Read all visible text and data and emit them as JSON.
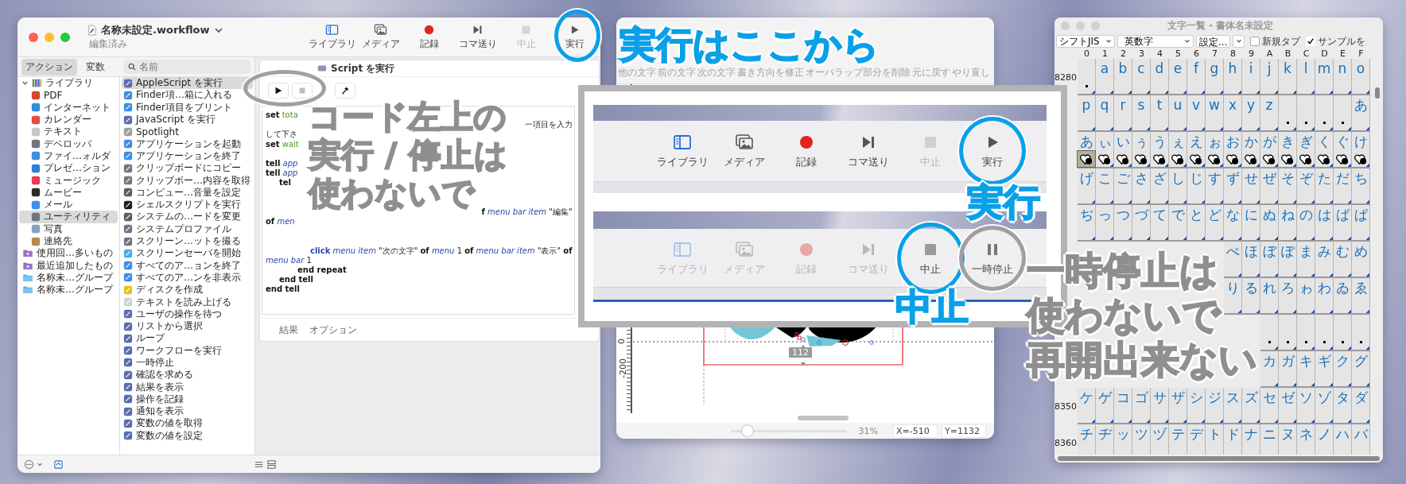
{
  "automator": {
    "title": "名称未設定.workflow",
    "subtitle": "編集済み",
    "toolbar": [
      {
        "label": "ライブラリ",
        "kind": "library",
        "disabled": false
      },
      {
        "label": "メディア",
        "kind": "media",
        "disabled": false
      },
      {
        "label": "記録",
        "kind": "record",
        "disabled": false
      },
      {
        "label": "コマ送り",
        "kind": "step",
        "disabled": false
      },
      {
        "label": "中止",
        "kind": "stop",
        "disabled": true
      },
      {
        "label": "実行",
        "kind": "run",
        "disabled": false
      }
    ],
    "sidebar_tabs": [
      {
        "label": "アクション",
        "selected": true
      },
      {
        "label": "変数",
        "selected": false
      }
    ],
    "search": {
      "placeholder": "名前"
    },
    "library": {
      "label": "ライブラリ",
      "expanded": true,
      "selected": false,
      "children": [
        {
          "label": "PDF",
          "color": "#d9442f",
          "selected": false
        },
        {
          "label": "インターネット",
          "color": "#2f8fd9",
          "selected": false
        },
        {
          "label": "カレンダー",
          "color": "#e84b3c",
          "selected": false
        },
        {
          "label": "テキスト",
          "color": "#c8c8c8",
          "selected": false
        },
        {
          "label": "デベロッパ",
          "color": "#6f7683",
          "selected": false
        },
        {
          "label": "ファイ…ォルダ",
          "color": "#3b8fe0",
          "selected": false
        },
        {
          "label": "プレゼ…ション",
          "color": "#2f7fe0",
          "selected": false
        },
        {
          "label": "ミュージック",
          "color": "#f03a4f",
          "selected": false
        },
        {
          "label": "ムービー",
          "color": "#2b2b2b",
          "selected": false
        },
        {
          "label": "メール",
          "color": "#3d8ff0",
          "selected": false
        },
        {
          "label": "ユーティリティ",
          "color": "#6f7683",
          "selected": true
        },
        {
          "label": "写真",
          "color": "#8aa0c0",
          "selected": false
        },
        {
          "label": "連絡先",
          "color": "#b58a4a",
          "selected": false
        }
      ]
    },
    "groups": [
      {
        "label": "使用回…多いもの",
        "kind": "smart",
        "selected": false
      },
      {
        "label": "最近追加したもの",
        "kind": "smart",
        "selected": false
      },
      {
        "label": "名称未…グループ",
        "kind": "folder",
        "selected": false
      },
      {
        "label": "名称未…グループ",
        "kind": "folder",
        "selected": false
      }
    ],
    "actions": [
      {
        "label": "AppleScript を実行",
        "color": "#5a6cb0",
        "selected": true
      },
      {
        "label": "Finder項…箱に入れる",
        "color": "#3a8ee6",
        "selected": false
      },
      {
        "label": "Finder項目をプリント",
        "color": "#3a8ee6",
        "selected": false
      },
      {
        "label": "JavaScript を実行",
        "color": "#5a6cb0",
        "selected": false
      },
      {
        "label": "Spotlight",
        "color": "#a0a0a0",
        "selected": false
      },
      {
        "label": "アプリケーションを起動",
        "color": "#3a8ee6",
        "selected": false
      },
      {
        "label": "アプリケーションを終了",
        "color": "#3a8ee6",
        "selected": false
      },
      {
        "label": "クリップボードにコピー",
        "color": "#6f7683",
        "selected": false
      },
      {
        "label": "クリップボー…内容を取得",
        "color": "#6f7683",
        "selected": false
      },
      {
        "label": "コンピュー…音量を設定",
        "color": "#5c5c5c",
        "selected": false
      },
      {
        "label": "シェルスクリプトを実行",
        "color": "#1e1e1e",
        "selected": false
      },
      {
        "label": "システムの…ードを変更",
        "color": "#5c5c5c",
        "selected": false
      },
      {
        "label": "システムプロファイル",
        "color": "#6f7683",
        "selected": false
      },
      {
        "label": "スクリーン…ットを撮る",
        "color": "#6f7683",
        "selected": false
      },
      {
        "label": "スクリーンセーバを開始",
        "color": "#4aa8e8",
        "selected": false
      },
      {
        "label": "すべてのア…ョンを終了",
        "color": "#3a8ee6",
        "selected": false
      },
      {
        "label": "すべてのア…ンを非表示",
        "color": "#3a8ee6",
        "selected": false
      },
      {
        "label": "ディスクを作成",
        "color": "#e8c21a",
        "selected": false
      },
      {
        "label": "テキストを読み上げる",
        "color": "#d0d0d0",
        "selected": false
      },
      {
        "label": "ユーザの操作を待つ",
        "color": "#5a6cb0",
        "selected": false
      },
      {
        "label": "リストから選択",
        "color": "#5a6cb0",
        "selected": false
      },
      {
        "label": "ループ",
        "color": "#5a6cb0",
        "selected": false
      },
      {
        "label": "ワークフローを実行",
        "color": "#5a6cb0",
        "selected": false
      },
      {
        "label": "一時停止",
        "color": "#5a6cb0",
        "selected": false
      },
      {
        "label": "確認を求める",
        "color": "#5a6cb0",
        "selected": false
      },
      {
        "label": "結果を表示",
        "color": "#5a6cb0",
        "selected": false
      },
      {
        "label": "操作を記録",
        "color": "#5a6cb0",
        "selected": false
      },
      {
        "label": "通知を表示",
        "color": "#5a6cb0",
        "selected": false
      },
      {
        "label": "変数の値を取得",
        "color": "#5a6cb0",
        "selected": false
      },
      {
        "label": "変数の値を設定",
        "color": "#5a6cb0",
        "selected": false
      }
    ],
    "action_card": {
      "title": "Script を実行",
      "code": [
        {
          "kind": "text",
          "left": [
            {
              "text": "set",
              "kind": "keyword"
            },
            {
              "text": " tota",
              "kind": "variable"
            }
          ]
        },
        {
          "kind": "text",
          "right": [
            {
              "text": "一項目を入力",
              "kind": "plain"
            }
          ]
        },
        {
          "kind": "text",
          "left": [
            {
              "text": "して下さ",
              "kind": "plain"
            }
          ]
        },
        {
          "kind": "text",
          "left": [
            {
              "text": "set",
              "kind": "keyword"
            },
            {
              "text": " wait",
              "kind": "variable"
            }
          ]
        },
        {
          "kind": "blank"
        },
        {
          "kind": "text",
          "left": [
            {
              "text": "tell",
              "kind": "keyword"
            },
            {
              "text": " app",
              "kind": "term"
            }
          ]
        },
        {
          "kind": "text",
          "left": [
            {
              "text": "tell",
              "kind": "keyword"
            },
            {
              "text": " app",
              "kind": "term"
            }
          ]
        },
        {
          "kind": "indent1",
          "left": [
            {
              "text": "tel",
              "kind": "keyword"
            }
          ]
        },
        {
          "kind": "blank"
        },
        {
          "kind": "blank"
        },
        {
          "kind": "text",
          "right": [
            {
              "text": "f",
              "kind": "keyword"
            },
            {
              "text": " menu bar item",
              "kind": "term"
            },
            {
              "text": " \"編集\"",
              "kind": "plain"
            }
          ]
        },
        {
          "kind": "text",
          "left": [
            {
              "text": "of",
              "kind": "keyword"
            },
            {
              "text": " men",
              "kind": "term"
            }
          ]
        },
        {
          "kind": "blank"
        },
        {
          "kind": "blank"
        },
        {
          "kind": "indent3",
          "left": [
            {
              "text": "click",
              "kind": "command"
            },
            {
              "text": " menu item",
              "kind": "term"
            },
            {
              "text": " \"次の文字\" ",
              "kind": "plain"
            },
            {
              "text": "of",
              "kind": "keyword"
            },
            {
              "text": " menu",
              "kind": "term"
            },
            {
              "text": " 1 ",
              "kind": "plain"
            },
            {
              "text": "of",
              "kind": "keyword"
            },
            {
              "text": " menu bar item",
              "kind": "term"
            },
            {
              "text": " \"表示\" ",
              "kind": "plain"
            },
            {
              "text": "of",
              "kind": "keyword"
            }
          ]
        },
        {
          "kind": "text",
          "left": [
            {
              "text": "menu bar",
              "kind": "term"
            },
            {
              "text": " 1",
              "kind": "plain"
            }
          ]
        },
        {
          "kind": "indent2",
          "left": [
            {
              "text": "end repeat",
              "kind": "keyword"
            }
          ]
        },
        {
          "kind": "indent1",
          "left": [
            {
              "text": "end tell",
              "kind": "keyword"
            }
          ]
        },
        {
          "kind": "text",
          "left": [
            {
              "text": "end tell",
              "kind": "keyword"
            }
          ]
        }
      ],
      "tabs": [
        {
          "label": "結果"
        },
        {
          "label": "オプション"
        }
      ]
    }
  },
  "editor": {
    "toolbar": [
      "他の文字",
      "前の文字",
      "次の文字",
      "書き方向を修正",
      "オーバラップ部分を削除",
      "元に戻す",
      "やり直し"
    ],
    "ruler_labels": [
      "0",
      "-200"
    ],
    "measure": "112",
    "zoom": {
      "level": 0.15,
      "reading": "31%"
    },
    "x": "X=-510",
    "y": "Y=1132"
  },
  "char_table": {
    "title": "文字一覧 - 書体名未設定",
    "encoding": "シフトJIS",
    "range": "英数字",
    "settings_button": "設定...",
    "new_tab": {
      "label": "新規タブ",
      "checked": false
    },
    "sample": {
      "label": "サンプルを",
      "checked": true
    },
    "columns": [
      "0",
      "1",
      "2",
      "3",
      "4",
      "5",
      "6",
      "7",
      "8",
      "9",
      "A",
      "B",
      "C",
      "D",
      "E",
      "F"
    ],
    "rows": [
      {
        "kind": "glyphs",
        "label": "8280",
        "cells": [
          {
            "dot": true,
            "selected": false
          },
          {
            "glyph": "a",
            "selected": false
          },
          {
            "glyph": "b",
            "selected": false
          },
          {
            "glyph": "c",
            "selected": false
          },
          {
            "glyph": "d",
            "selected": false
          },
          {
            "glyph": "e",
            "selected": false
          },
          {
            "glyph": "f",
            "selected": false
          },
          {
            "glyph": "g",
            "selected": false
          },
          {
            "glyph": "h",
            "selected": false
          },
          {
            "glyph": "i",
            "selected": false
          },
          {
            "glyph": "j",
            "selected": false
          },
          {
            "glyph": "k",
            "selected": false
          },
          {
            "glyph": "l",
            "selected": false
          },
          {
            "glyph": "m",
            "selected": false
          },
          {
            "glyph": "n",
            "selected": false
          },
          {
            "glyph": "o",
            "selected": false
          }
        ]
      },
      {
        "kind": "glyphs",
        "cells": [
          {
            "glyph": "p",
            "selected": false
          },
          {
            "glyph": "q",
            "selected": false
          },
          {
            "glyph": "r",
            "selected": false
          },
          {
            "glyph": "s",
            "selected": false
          },
          {
            "glyph": "t",
            "selected": false
          },
          {
            "glyph": "u",
            "selected": false
          },
          {
            "glyph": "v",
            "selected": false
          },
          {
            "glyph": "w",
            "selected": false
          },
          {
            "glyph": "x",
            "selected": false
          },
          {
            "glyph": "y",
            "selected": false
          },
          {
            "glyph": "z",
            "selected": false
          },
          {
            "dot": true,
            "selected": false
          },
          {
            "dot": true,
            "selected": false
          },
          {
            "dot": true,
            "selected": false
          },
          {
            "dot": true,
            "selected": false
          },
          {
            "glyph": "あ",
            "selected": false
          }
        ]
      },
      {
        "kind": "samples",
        "cells": [
          {
            "glyph": "あ",
            "selected": true
          },
          {
            "glyph": "ぃ",
            "selected": false
          },
          {
            "glyph": "い",
            "selected": false
          },
          {
            "glyph": "ぅ",
            "selected": false
          },
          {
            "glyph": "う",
            "selected": false
          },
          {
            "glyph": "ぇ",
            "selected": false
          },
          {
            "glyph": "え",
            "selected": false
          },
          {
            "glyph": "ぉ",
            "selected": false
          },
          {
            "glyph": "お",
            "selected": false
          },
          {
            "glyph": "か",
            "selected": false
          },
          {
            "glyph": "が",
            "selected": false
          },
          {
            "glyph": "き",
            "selected": false
          },
          {
            "glyph": "ぎ",
            "selected": false
          },
          {
            "glyph": "く",
            "selected": false
          },
          {
            "glyph": "ぐ",
            "selected": false
          },
          {
            "glyph": "け",
            "selected": false
          }
        ]
      },
      {
        "kind": "glyphs",
        "cells": [
          {
            "glyph": "げ",
            "selected": false
          },
          {
            "glyph": "こ",
            "selected": false
          },
          {
            "glyph": "ご",
            "selected": false
          },
          {
            "glyph": "さ",
            "selected": false
          },
          {
            "glyph": "ざ",
            "selected": false
          },
          {
            "glyph": "し",
            "selected": false
          },
          {
            "glyph": "じ",
            "selected": false
          },
          {
            "glyph": "す",
            "selected": false
          },
          {
            "glyph": "ず",
            "selected": false
          },
          {
            "glyph": "せ",
            "selected": false
          },
          {
            "glyph": "ぜ",
            "selected": false
          },
          {
            "glyph": "そ",
            "selected": false
          },
          {
            "glyph": "ぞ",
            "selected": false
          },
          {
            "glyph": "た",
            "selected": false
          },
          {
            "glyph": "だ",
            "selected": false
          },
          {
            "glyph": "ち",
            "selected": false
          }
        ]
      },
      {
        "kind": "glyphs",
        "cells": [
          {
            "glyph": "ぢ",
            "selected": false
          },
          {
            "glyph": "っ",
            "selected": false
          },
          {
            "glyph": "つ",
            "selected": false
          },
          {
            "glyph": "づ",
            "selected": false
          },
          {
            "glyph": "て",
            "selected": false
          },
          {
            "glyph": "で",
            "selected": false
          },
          {
            "glyph": "と",
            "selected": false
          },
          {
            "glyph": "ど",
            "selected": false
          },
          {
            "glyph": "な",
            "selected": false
          },
          {
            "glyph": "に",
            "selected": false
          },
          {
            "glyph": "ぬ",
            "selected": false
          },
          {
            "glyph": "ね",
            "selected": false
          },
          {
            "glyph": "の",
            "selected": false
          },
          {
            "glyph": "は",
            "selected": false
          },
          {
            "glyph": "ば",
            "selected": false
          },
          {
            "glyph": "ぱ",
            "selected": false
          }
        ]
      },
      {
        "kind": "glyphs",
        "cells": [
          null,
          null,
          null,
          null,
          null,
          null,
          null,
          null,
          {
            "glyph": "ぺ",
            "selected": false
          },
          {
            "glyph": "ほ",
            "selected": false
          },
          {
            "glyph": "ぼ",
            "selected": false
          },
          {
            "glyph": "ぽ",
            "selected": false
          },
          {
            "glyph": "ま",
            "selected": false
          },
          {
            "glyph": "み",
            "selected": false
          },
          {
            "glyph": "む",
            "selected": false
          },
          {
            "glyph": "め",
            "selected": false
          }
        ]
      },
      {
        "kind": "glyphs",
        "cells": [
          null,
          null,
          null,
          null,
          null,
          null,
          null,
          null,
          {
            "glyph": "り",
            "selected": false
          },
          {
            "glyph": "る",
            "selected": false
          },
          {
            "glyph": "れ",
            "selected": false
          },
          {
            "glyph": "ろ",
            "selected": false
          },
          {
            "glyph": "ゎ",
            "selected": false
          },
          {
            "glyph": "わ",
            "selected": false
          },
          {
            "glyph": "ゐ",
            "selected": false
          },
          {
            "glyph": "ゑ",
            "selected": false
          }
        ]
      },
      {
        "kind": "glyphs",
        "cells": [
          null,
          null,
          null,
          null,
          null,
          null,
          null,
          null,
          null,
          null,
          {
            "dot": true,
            "selected": false
          },
          {
            "dot": true,
            "selected": false
          },
          {
            "dot": true,
            "selected": false
          },
          {
            "dot": true,
            "selected": false
          },
          {
            "dot": true,
            "selected": false
          },
          {
            "dot": true,
            "selected": false
          }
        ]
      },
      {
        "kind": "glyphs",
        "cells": [
          null,
          null,
          null,
          null,
          null,
          null,
          null,
          null,
          null,
          null,
          {
            "glyph": "カ",
            "selected": false
          },
          {
            "glyph": "ガ",
            "selected": false
          },
          {
            "glyph": "キ",
            "selected": false
          },
          {
            "glyph": "ギ",
            "selected": false
          },
          {
            "glyph": "ク",
            "selected": false
          },
          {
            "glyph": "グ",
            "selected": false
          }
        ]
      },
      {
        "kind": "glyphs",
        "label": "8350",
        "cells": [
          {
            "glyph": "ケ",
            "selected": false
          },
          {
            "glyph": "ゲ",
            "selected": false
          },
          {
            "glyph": "コ",
            "selected": false
          },
          {
            "glyph": "ゴ",
            "selected": false
          },
          {
            "glyph": "サ",
            "selected": false
          },
          {
            "glyph": "ザ",
            "selected": false
          },
          {
            "glyph": "シ",
            "selected": false
          },
          {
            "glyph": "ジ",
            "selected": false
          },
          {
            "glyph": "ス",
            "selected": false
          },
          {
            "glyph": "ズ",
            "selected": false
          },
          {
            "glyph": "セ",
            "selected": false
          },
          {
            "glyph": "ゼ",
            "selected": false
          },
          {
            "glyph": "ソ",
            "selected": false
          },
          {
            "glyph": "ゾ",
            "selected": false
          },
          {
            "glyph": "タ",
            "selected": false
          },
          {
            "glyph": "ダ",
            "selected": false
          }
        ]
      },
      {
        "kind": "glyphs",
        "label": "8360",
        "cells": [
          {
            "glyph": "チ",
            "selected": false
          },
          {
            "glyph": "ヂ",
            "selected": false
          },
          {
            "glyph": "ッ",
            "selected": false
          },
          {
            "glyph": "ツ",
            "selected": false
          },
          {
            "glyph": "ヅ",
            "selected": false
          },
          {
            "glyph": "テ",
            "selected": false
          },
          {
            "glyph": "デ",
            "selected": false
          },
          {
            "glyph": "ト",
            "selected": false
          },
          {
            "glyph": "ド",
            "selected": false
          },
          {
            "glyph": "ナ",
            "selected": false
          },
          {
            "glyph": "ニ",
            "selected": false
          },
          {
            "glyph": "ヌ",
            "selected": false
          },
          {
            "glyph": "ネ",
            "selected": false
          },
          {
            "glyph": "ノ",
            "selected": false
          },
          {
            "glyph": "ハ",
            "selected": false
          },
          {
            "glyph": "バ",
            "selected": false
          }
        ]
      }
    ]
  },
  "inset": {
    "toolbars": [
      {
        "buttons": [
          {
            "label": "ライブラリ",
            "kind": "library",
            "disabled": false
          },
          {
            "label": "メディア",
            "kind": "media",
            "disabled": false
          },
          {
            "label": "記録",
            "kind": "record",
            "disabled": false
          },
          {
            "label": "コマ送り",
            "kind": "step",
            "disabled": false
          },
          {
            "label": "中止",
            "kind": "stop",
            "disabled": true
          },
          {
            "label": "実行",
            "kind": "run",
            "disabled": false
          }
        ]
      },
      {
        "buttons": [
          {
            "label": "ライブラリ",
            "kind": "library",
            "disabled": true
          },
          {
            "label": "メディア",
            "kind": "media",
            "disabled": true
          },
          {
            "label": "記録",
            "kind": "record",
            "disabled": true
          },
          {
            "label": "コマ送り",
            "kind": "step",
            "disabled": true
          },
          {
            "label": "中止",
            "kind": "stop",
            "disabled": false
          },
          {
            "label": "一時停止",
            "kind": "pause",
            "disabled": false
          }
        ]
      }
    ]
  },
  "callouts": [
    {
      "kind": "ring",
      "color": "#0aa0e8"
    },
    {
      "kind": "text",
      "color": "#0aa0e8",
      "lines": [
        "実行はここから"
      ]
    },
    {
      "kind": "ring",
      "color": "#a0a0a0"
    },
    {
      "kind": "text",
      "color": "#8f8f8f",
      "lines": [
        "コード左上の",
        "実行 / 停止は",
        "使わないで"
      ]
    },
    {
      "kind": "ring",
      "color": "#0aa0e8"
    },
    {
      "kind": "text",
      "color": "#0aa0e8",
      "lines": [
        "実行"
      ]
    },
    {
      "kind": "ring",
      "color": "#0aa0e8"
    },
    {
      "kind": "ring",
      "color": "#a0a0a0"
    },
    {
      "kind": "text",
      "color": "#0aa0e8",
      "lines": [
        "中止"
      ]
    },
    {
      "kind": "text",
      "color": "#8f8f8f",
      "lines": [
        "一時停止は",
        "使わないで",
        "再開出来ない"
      ]
    }
  ]
}
